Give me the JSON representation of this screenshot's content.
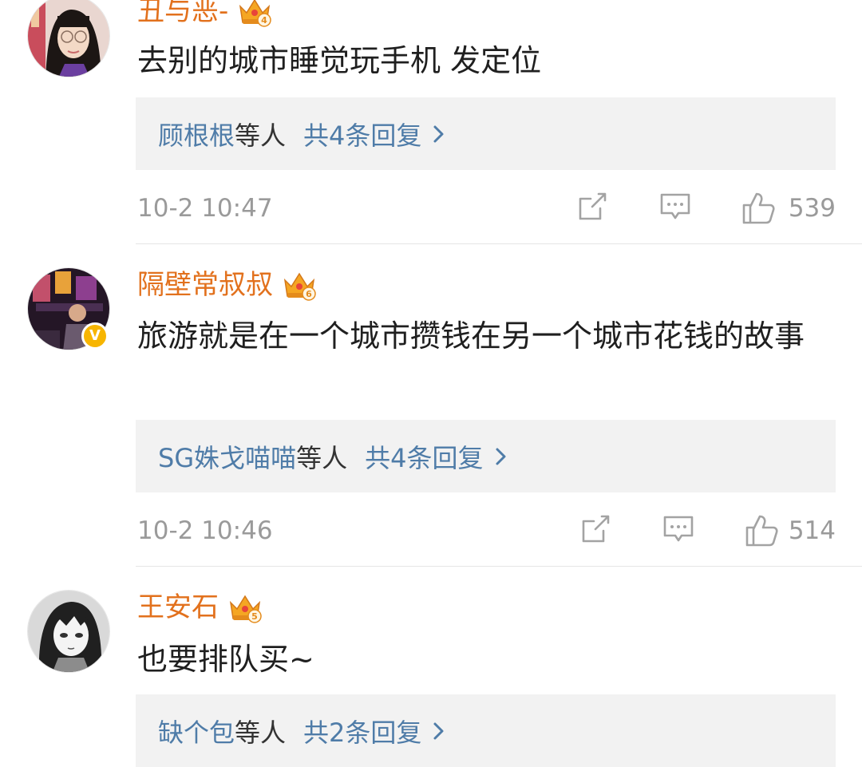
{
  "comments": [
    {
      "username": "丑与恶-",
      "crown_badge": "4",
      "content": "去别的城市睡觉玩手机 发定位",
      "reply_names": "顾根根",
      "reply_suffix": "等人",
      "reply_count": "共4条回复",
      "time": "10-2 10:47",
      "likes": "539"
    },
    {
      "username": "隔壁常叔叔",
      "crown_badge": "6",
      "verified": "V",
      "content": "旅游就是在一个城市攒钱在另一个城市花钱的故事",
      "reply_names": "SG姝戈喵喵",
      "reply_suffix": "等人",
      "reply_count": "共4条回复",
      "time": "10-2 10:46",
      "likes": "514"
    },
    {
      "username": "王安石",
      "crown_badge": "5",
      "content": "也要排队买~",
      "reply_names": "缺个包",
      "reply_suffix": "等人",
      "reply_count": "共2条回复"
    }
  ],
  "icons": {
    "share": "share-icon",
    "comment": "comment-icon",
    "like": "like-icon",
    "crown": "crown-badge-icon",
    "chevron": "chevron-right-icon",
    "verified": "verified-badge-icon"
  },
  "colors": {
    "username": "#e2711d",
    "reply_link": "#4f7ca8",
    "meta_text": "#9a9a9a",
    "reply_bg": "#f2f2f2",
    "crown": "#f5a623",
    "verified": "#f7b500"
  }
}
